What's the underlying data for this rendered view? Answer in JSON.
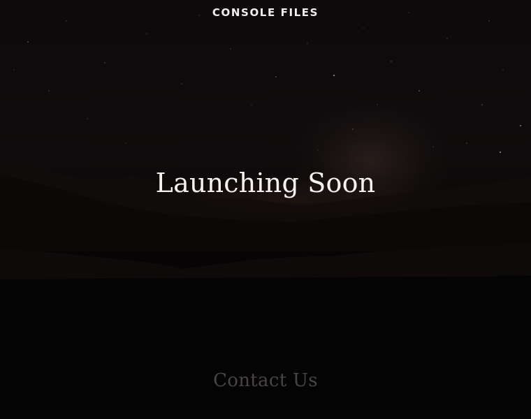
{
  "header": {
    "brand_name": "CONSOLE FILES"
  },
  "hero": {
    "headline": "Launching Soon",
    "background_icon": "night-mountain-landscape"
  },
  "footer": {
    "contact_label": "Contact Us"
  },
  "colors": {
    "background": "#070506",
    "headline_text": "#f4f1ee",
    "brand_text": "#f2f0ee",
    "contact_text": "#4a4446"
  }
}
